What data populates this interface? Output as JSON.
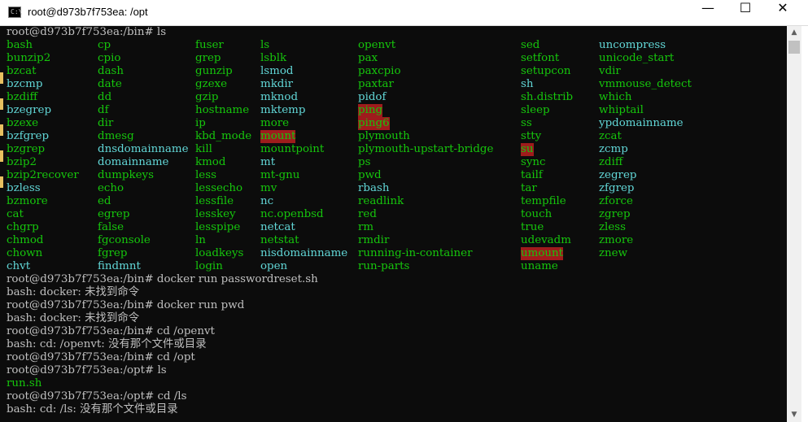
{
  "window": {
    "title": "root@d973b7f753ea: /opt",
    "icon": "console-icon",
    "icon_text": "C:\\",
    "minimize": "—",
    "maximize": "☐",
    "close": "✕"
  },
  "ls_prompt": "root@d973b7f753ea:/bin# ls",
  "ls_columns": [
    [
      "bash",
      "bunzip2",
      "bzcat",
      "bzcmp",
      "bzdiff",
      "bzegrep",
      "bzexe",
      "bzfgrep",
      "bzgrep",
      "bzip2",
      "bzip2recover",
      "bzless",
      "bzmore",
      "cat",
      "chgrp",
      "chmod",
      "chown",
      "chvt"
    ],
    [
      "cp",
      "cpio",
      "dash",
      "date",
      "dd",
      "df",
      "dir",
      "dmesg",
      "dnsdomainname",
      "domainname",
      "dumpkeys",
      "echo",
      "ed",
      "egrep",
      "false",
      "fgconsole",
      "fgrep",
      "findmnt"
    ],
    [
      "fuser",
      "grep",
      "gunzip",
      "gzexe",
      "gzip",
      "hostname",
      "ip",
      "kbd_mode",
      "kill",
      "kmod",
      "less",
      "lessecho",
      "lessfile",
      "lesskey",
      "lesspipe",
      "ln",
      "loadkeys",
      "login"
    ],
    [
      "ls",
      "lsblk",
      "lsmod",
      "mkdir",
      "mknod",
      "mktemp",
      "more",
      "mount",
      "mountpoint",
      "mt",
      "mt-gnu",
      "mv",
      "nc",
      "nc.openbsd",
      "netcat",
      "netstat",
      "nisdomainname",
      "open"
    ],
    [
      "openvt",
      "pax",
      "paxcpio",
      "paxtar",
      "pidof",
      "ping",
      "ping6",
      "plymouth",
      "plymouth-upstart-bridge",
      "ps",
      "pwd",
      "rbash",
      "readlink",
      "red",
      "rm",
      "rmdir",
      "running-in-container",
      "run-parts"
    ],
    [
      "sed",
      "setfont",
      "setupcon",
      "sh",
      "sh.distrib",
      "sleep",
      "ss",
      "stty",
      "su",
      "sync",
      "tailf",
      "tar",
      "tempfile",
      "touch",
      "true",
      "udevadm",
      "umount",
      "uname"
    ],
    [
      "uncompress",
      "unicode_start",
      "vdir",
      "vmmouse_detect",
      "which",
      "whiptail",
      "ypdomainname",
      "zcat",
      "zcmp",
      "zdiff",
      "zegrep",
      "zfgrep",
      "zforce",
      "zgrep",
      "zless",
      "zmore",
      "znew",
      ""
    ]
  ],
  "highlighted": [
    "mount",
    "ping",
    "ping6",
    "su",
    "umount"
  ],
  "links": [
    "bzcmp",
    "bzegrep",
    "bzfgrep",
    "bzless",
    "dnsdomainname",
    "domainname",
    "nisdomainname",
    "pidof",
    "ypdomainname",
    "lsmod",
    "mt",
    "nc",
    "netcat",
    "open",
    "rbash",
    "sh",
    "zcmp",
    "zegrep",
    "zfgrep",
    "chvt",
    "uncompress",
    "findmnt",
    "mkdir",
    "mknod",
    "mktemp"
  ],
  "history": [
    {
      "text": "root@d973b7f753ea:/bin# docker run passwordreset.sh",
      "kind": "normal"
    },
    {
      "text": "bash: docker: 未找到命令",
      "kind": "normal"
    },
    {
      "text": "root@d973b7f753ea:/bin# docker run pwd",
      "kind": "normal"
    },
    {
      "text": "bash: docker: 未找到命令",
      "kind": "normal"
    },
    {
      "text": "root@d973b7f753ea:/bin# cd /openvt",
      "kind": "normal"
    },
    {
      "text": "bash: cd: /openvt: 没有那个文件或目录",
      "kind": "normal"
    },
    {
      "text": "root@d973b7f753ea:/bin# cd /opt",
      "kind": "normal"
    },
    {
      "text": "root@d973b7f753ea:/opt# ls",
      "kind": "normal"
    },
    {
      "text": "run.sh",
      "kind": "exec"
    },
    {
      "text": "root@d973b7f753ea:/opt# cd /ls",
      "kind": "normal"
    },
    {
      "text": "bash: cd: /ls: 没有那个文件或目录",
      "kind": "normal"
    }
  ],
  "colors": {
    "text": "#c0c0c0",
    "executable": "#16c60c",
    "highlight_bg": "#9e1c1c",
    "link": "#61d6d6",
    "background": "#0c0c0c"
  }
}
